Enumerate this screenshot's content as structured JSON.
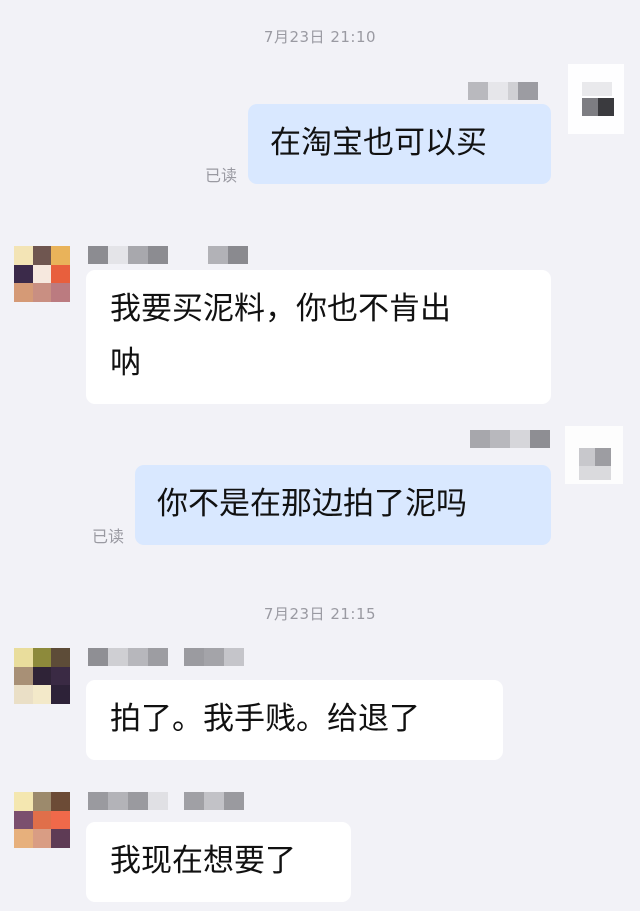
{
  "timestamps": [
    "7月23日 21:10",
    "7月23日 21:15"
  ],
  "read_label": "已读",
  "messages": [
    {
      "direction": "out",
      "text": "在淘宝也可以买",
      "read": true
    },
    {
      "direction": "in",
      "lines": [
        "我要买泥料，你也不肯出",
        "呐"
      ]
    },
    {
      "direction": "out",
      "text": "你不是在那边拍了泥吗",
      "read": true
    },
    {
      "direction": "in",
      "text": "拍了。我手贱。给退了"
    },
    {
      "direction": "in",
      "text": "我现在想要了"
    }
  ],
  "colors": {
    "background": "#f2f2f7",
    "outgoing_bubble": "#d9e8ff",
    "incoming_bubble": "#ffffff",
    "meta_text": "#9a9aa2"
  }
}
